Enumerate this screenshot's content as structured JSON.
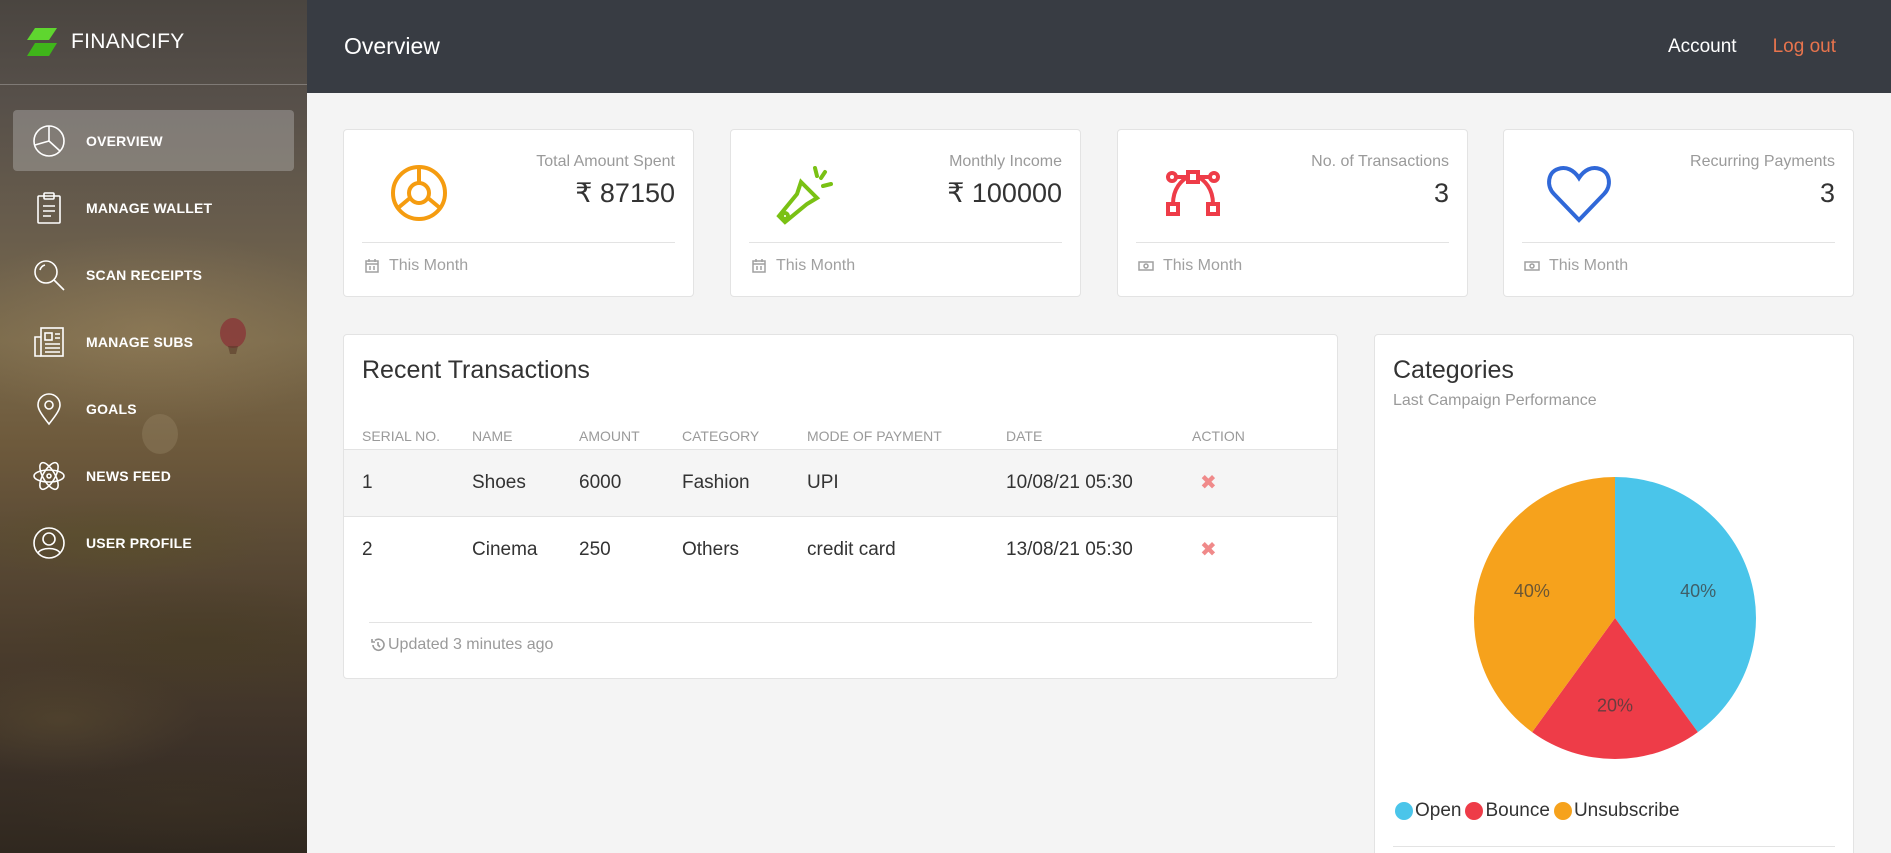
{
  "brand": {
    "name": "FINANCIFY",
    "logo_color": "#5fd62f"
  },
  "sidebar": {
    "items": [
      {
        "label": "OVERVIEW",
        "icon": "pie-chart-icon",
        "active": true
      },
      {
        "label": "MANAGE WALLET",
        "icon": "clipboard-icon"
      },
      {
        "label": "SCAN RECEIPTS",
        "icon": "search-icon"
      },
      {
        "label": "MANAGE SUBS",
        "icon": "newspaper-icon"
      },
      {
        "label": "GOALS",
        "icon": "map-pin-icon"
      },
      {
        "label": "NEWS FEED",
        "icon": "atom-icon"
      },
      {
        "label": "USER PROFILE",
        "icon": "user-icon"
      }
    ]
  },
  "topbar": {
    "title": "Overview",
    "account": "Account",
    "logout": "Log out",
    "logout_color": "#e8744d"
  },
  "stats": [
    {
      "category": "Total Amount Spent",
      "value": "₹ 87150",
      "footer": "This Month",
      "icon": "target-icon",
      "color": "#f59c10",
      "footer_icon": "calendar-icon"
    },
    {
      "category": "Monthly Income",
      "value": "₹ 100000",
      "footer": "This Month",
      "icon": "flashlight-icon",
      "color": "#7ac114",
      "footer_icon": "calendar-icon"
    },
    {
      "category": "No. of Transactions",
      "value": "3",
      "footer": "This Month",
      "icon": "vector-path-icon",
      "color": "#ee3c48",
      "footer_icon": "money-icon"
    },
    {
      "category": "Recurring Payments",
      "value": "3",
      "footer": "This Month",
      "icon": "heart-icon",
      "color": "#3068d8",
      "footer_icon": "money-icon"
    }
  ],
  "transactions": {
    "title": "Recent Transactions",
    "headers": [
      "SERIAL NO.",
      "NAME",
      "AMOUNT",
      "CATEGORY",
      "MODE OF PAYMENT",
      "DATE",
      "ACTION"
    ],
    "rows": [
      {
        "serial": "1",
        "name": "Shoes",
        "amount": "6000",
        "category": "Fashion",
        "mode": "UPI",
        "date": "10/08/21 05:30",
        "action": "✖"
      },
      {
        "serial": "2",
        "name": "Cinema",
        "amount": "250",
        "category": "Others",
        "mode": "credit card",
        "date": "13/08/21 05:30",
        "action": "✖"
      }
    ],
    "footer": "Updated 3 minutes ago"
  },
  "categories": {
    "title": "Categories",
    "subtitle": "Last Campaign Performance",
    "legend": [
      {
        "label": "Open",
        "color": "#4ac5ea"
      },
      {
        "label": "Bounce",
        "color": "#ee3c48"
      },
      {
        "label": "Unsubscribe",
        "color": "#f6a21c"
      }
    ]
  },
  "chart_data": {
    "type": "pie",
    "categories": [
      "Open",
      "Bounce",
      "Unsubscribe"
    ],
    "values": [
      40,
      20,
      40
    ],
    "labels": [
      "40%",
      "20%",
      "40%"
    ],
    "colors": [
      "#4ac5ea",
      "#ee3c48",
      "#f6a21c"
    ],
    "legend": "bottom-left"
  }
}
